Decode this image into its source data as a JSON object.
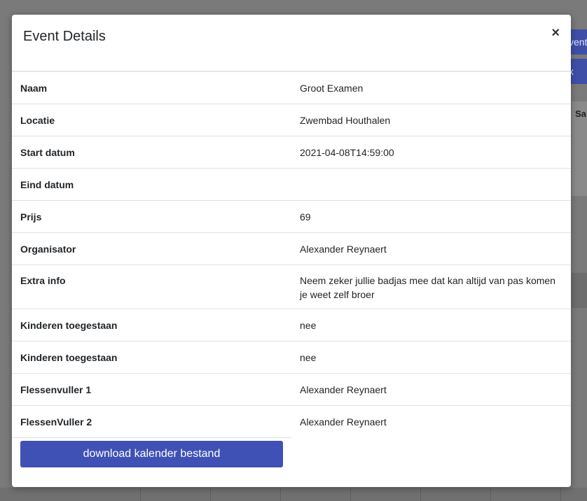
{
  "background": {
    "button1_label": "vent",
    "button2_label": "k",
    "day_label": "Sa"
  },
  "modal": {
    "title": "Event Details",
    "close_symbol": "×",
    "rows": [
      {
        "label": "Naam",
        "value": "Groot Examen"
      },
      {
        "label": "Locatie",
        "value": "Zwembad Houthalen"
      },
      {
        "label": "Start datum",
        "value": "2021-04-08T14:59:00"
      },
      {
        "label": "Eind datum",
        "value": ""
      },
      {
        "label": "Prijs",
        "value": "69"
      },
      {
        "label": "Organisator",
        "value": "Alexander Reynaert"
      },
      {
        "label": "Extra info",
        "value": "Neem zeker jullie badjas mee dat kan altijd van pas komen je weet zelf broer"
      },
      {
        "label": "Kinderen toegestaan",
        "value": "nee"
      },
      {
        "label": "Kinderen toegestaan",
        "value": "nee"
      },
      {
        "label": "Flessenvuller 1",
        "value": "Alexander Reynaert"
      },
      {
        "label": "FlessenVuller 2",
        "value": "Alexander Reynaert"
      }
    ],
    "download_label": "download kalender bestand"
  }
}
